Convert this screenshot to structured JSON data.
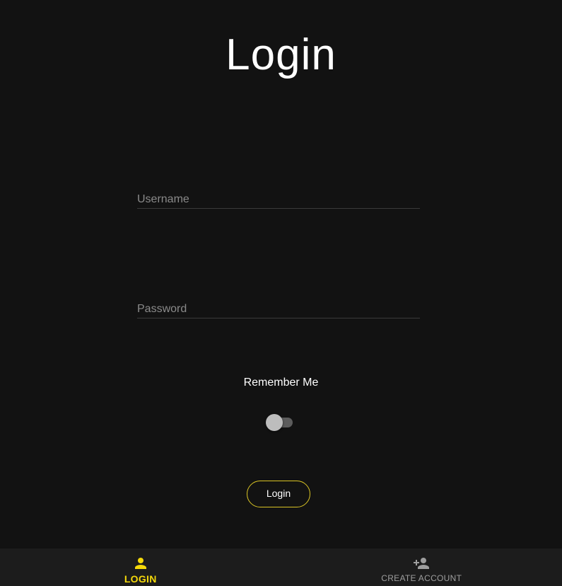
{
  "header": {
    "title": "Login"
  },
  "form": {
    "username_placeholder": "Username",
    "username_value": "",
    "password_placeholder": "Password",
    "password_value": "",
    "remember_label": "Remember Me",
    "remember_on": false,
    "login_button_label": "Login"
  },
  "bottom_nav": {
    "items": [
      {
        "label": "LOGIN",
        "icon": "person-icon",
        "active": true
      },
      {
        "label": "CREATE ACCOUNT",
        "icon": "person-add-icon",
        "active": false
      }
    ]
  },
  "colors": {
    "background": "#121212",
    "accent": "#f5d90a",
    "nav_background": "#1c1c1c"
  }
}
